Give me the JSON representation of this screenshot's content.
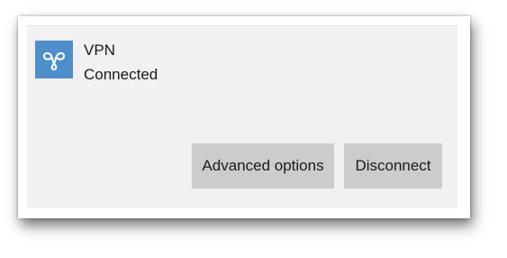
{
  "connection": {
    "name": "VPN",
    "status": "Connected",
    "icon": "vpn-icon",
    "tile_color": "#4e8fcb"
  },
  "actions": {
    "advanced_label": "Advanced options",
    "disconnect_label": "Disconnect"
  }
}
